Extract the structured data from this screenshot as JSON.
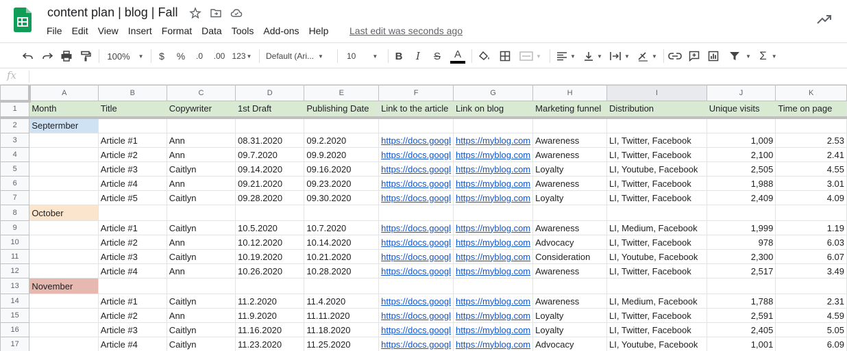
{
  "doc": {
    "title": "content plan | blog | Fall",
    "last_edit": "Last edit was seconds ago"
  },
  "menu": [
    "File",
    "Edit",
    "View",
    "Insert",
    "Format",
    "Data",
    "Tools",
    "Add-ons",
    "Help"
  ],
  "toolbar": {
    "zoom": "100%",
    "currency": "$",
    "percent": "%",
    "dec_decrease": ".0",
    "dec_increase": ".00",
    "more_formats": "123",
    "font": "Default (Ari...",
    "font_size": "10",
    "text_color_letter": "A"
  },
  "formula": {
    "fx": "fx",
    "value": ""
  },
  "columns": [
    "A",
    "B",
    "C",
    "D",
    "E",
    "F",
    "G",
    "H",
    "I",
    "J",
    "K"
  ],
  "headers": [
    "Month",
    "Title",
    "Copywriter",
    "1st Draft",
    "Publishing Date",
    "Link to the article",
    "Link on blog",
    "Marketing funnel",
    "Distribution",
    "Unique visits",
    "Time on page"
  ],
  "rows": [
    {
      "n": "2",
      "month": "Septermber",
      "tone": "sep"
    },
    {
      "n": "3",
      "cells": [
        "",
        "Article #1",
        "Ann",
        "08.31.2020",
        "09.2.2020",
        "https://docs.googl",
        "https://myblog.com",
        "Awareness",
        "LI, Twitter, Facebook",
        "1,009",
        "2.53"
      ]
    },
    {
      "n": "4",
      "cells": [
        "",
        "Article #2",
        "Ann",
        "09.7.2020",
        "09.9.2020",
        "https://docs.googl",
        "https://myblog.com",
        "Awareness",
        "LI, Twitter, Facebook",
        "2,100",
        "2.41"
      ]
    },
    {
      "n": "5",
      "cells": [
        "",
        "Article #3",
        "Caitlyn",
        "09.14.2020",
        "09.16.2020",
        "https://docs.googl",
        "https://myblog.com",
        "Loyalty",
        "LI, Youtube, Facebook",
        "2,505",
        "4.55"
      ]
    },
    {
      "n": "6",
      "cells": [
        "",
        "Article #4",
        "Ann",
        "09.21.2020",
        "09.23.2020",
        "https://docs.googl",
        "https://myblog.com",
        "Awareness",
        "LI, Twitter, Facebook",
        "1,988",
        "3.01"
      ]
    },
    {
      "n": "7",
      "cells": [
        "",
        "Article #5",
        "Caitlyn",
        "09.28.2020",
        "09.30.2020",
        "https://docs.googl",
        "https://myblog.com",
        "Loyalty",
        "LI, Twitter, Facebook",
        "2,409",
        "4.09"
      ]
    },
    {
      "n": "8",
      "month": "October",
      "tone": "oct"
    },
    {
      "n": "9",
      "cells": [
        "",
        "Article #1",
        "Caitlyn",
        "10.5.2020",
        "10.7.2020",
        "https://docs.googl",
        "https://myblog.com",
        "Awareness",
        "LI, Medium, Facebook",
        "1,999",
        "1.19"
      ]
    },
    {
      "n": "10",
      "cells": [
        "",
        "Article #2",
        "Ann",
        "10.12.2020",
        "10.14.2020",
        "https://docs.googl",
        "https://myblog.com",
        "Advocacy",
        "LI, Twitter, Facebook",
        "978",
        "6.03"
      ]
    },
    {
      "n": "11",
      "cells": [
        "",
        "Article #3",
        "Caitlyn",
        "10.19.2020",
        "10.21.2020",
        "https://docs.googl",
        "https://myblog.com",
        "Consideration",
        "LI, Youtube, Facebook",
        "2,300",
        "6.07"
      ]
    },
    {
      "n": "12",
      "cells": [
        "",
        "Article #4",
        "Ann",
        "10.26.2020",
        "10.28.2020",
        "https://docs.googl",
        "https://myblog.com",
        "Awareness",
        "LI, Twitter, Facebook",
        "2,517",
        "3.49"
      ]
    },
    {
      "n": "13",
      "month": "November",
      "tone": "nov"
    },
    {
      "n": "14",
      "cells": [
        "",
        "Article #1",
        "Caitlyn",
        "11.2.2020",
        "11.4.2020",
        "https://docs.googl",
        "https://myblog.com",
        "Awareness",
        "LI, Medium, Facebook",
        "1,788",
        "2.31"
      ]
    },
    {
      "n": "15",
      "cells": [
        "",
        "Article #2",
        "Ann",
        "11.9.2020",
        "11.11.2020",
        "https://docs.googl",
        "https://myblog.com",
        "Loyalty",
        "LI, Twitter, Facebook",
        "2,591",
        "4.59"
      ]
    },
    {
      "n": "16",
      "cells": [
        "",
        "Article #3",
        "Caitlyn",
        "11.16.2020",
        "11.18.2020",
        "https://docs.googl",
        "https://myblog.com",
        "Loyalty",
        "LI, Twitter, Facebook",
        "2,405",
        "5.05"
      ]
    },
    {
      "n": "17",
      "cells": [
        "",
        "Article #4",
        "Caitlyn",
        "11.23.2020",
        "11.25.2020",
        "https://docs.googl",
        "https://myblog.com",
        "Advocacy",
        "LI, Youtube, Facebook",
        "1,001",
        "6.09"
      ]
    }
  ],
  "colors": {
    "header_fill": "#d9ead3",
    "september_fill": "#cfe2f3",
    "october_fill": "#fce5cd",
    "november_fill": "#e6b8af",
    "link": "#1155cc",
    "logo": "#0f9d58"
  }
}
